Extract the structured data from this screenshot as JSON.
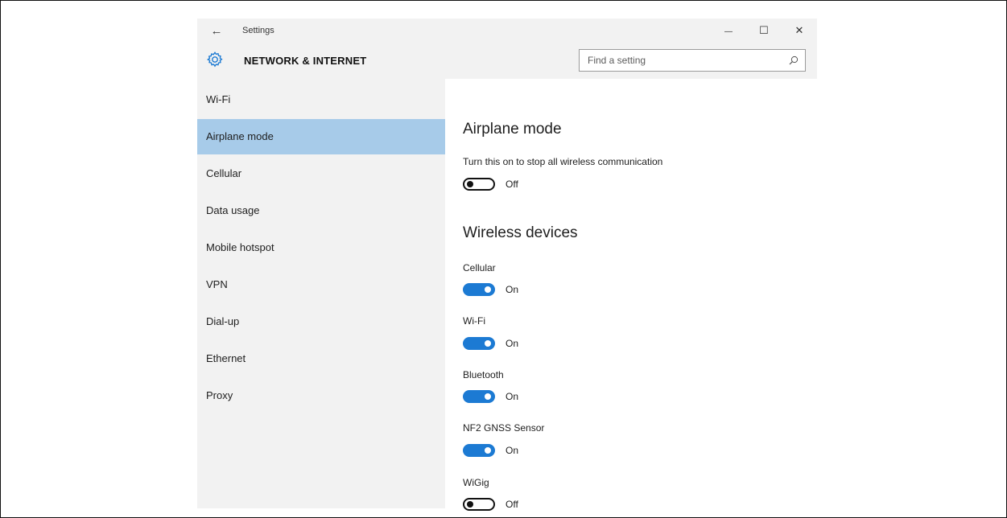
{
  "window": {
    "title": "Settings",
    "back_glyph": "←",
    "minimize_glyph": "—",
    "maximize_glyph": "☐",
    "close_glyph": "✕"
  },
  "header": {
    "section_title": "NETWORK & INTERNET",
    "section_icon": "gear-icon"
  },
  "search": {
    "placeholder": "Find a setting",
    "value": "",
    "icon": "search-icon"
  },
  "sidebar": {
    "items": [
      {
        "label": "Wi-Fi",
        "selected": false
      },
      {
        "label": "Airplane mode",
        "selected": true
      },
      {
        "label": "Cellular",
        "selected": false
      },
      {
        "label": "Data usage",
        "selected": false
      },
      {
        "label": "Mobile hotspot",
        "selected": false
      },
      {
        "label": "VPN",
        "selected": false
      },
      {
        "label": "Dial-up",
        "selected": false
      },
      {
        "label": "Ethernet",
        "selected": false
      },
      {
        "label": "Proxy",
        "selected": false
      }
    ]
  },
  "main": {
    "airplane": {
      "heading": "Airplane mode",
      "description": "Turn this on to stop all wireless communication",
      "toggle": {
        "state": "Off",
        "on": false
      }
    },
    "wireless": {
      "heading": "Wireless devices",
      "devices": [
        {
          "label": "Cellular",
          "state": "On",
          "on": true
        },
        {
          "label": "Wi-Fi",
          "state": "On",
          "on": true
        },
        {
          "label": "Bluetooth",
          "state": "On",
          "on": true
        },
        {
          "label": "NF2 GNSS Sensor",
          "state": "On",
          "on": true
        },
        {
          "label": "WiGig",
          "state": "Off",
          "on": false
        }
      ]
    }
  },
  "colors": {
    "accent": "#1c7ad3",
    "selected_bg": "#a7cbe9",
    "sidebar_bg": "#f2f2f2"
  }
}
